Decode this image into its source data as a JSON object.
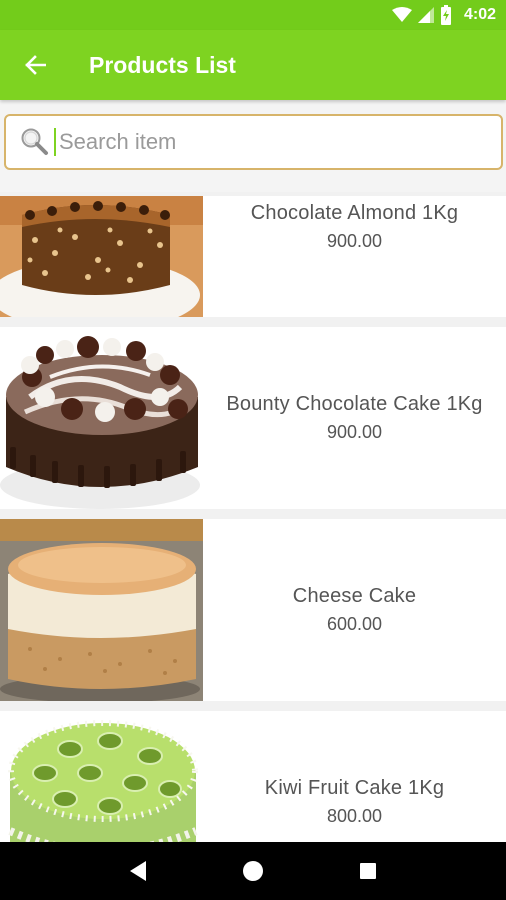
{
  "status_bar": {
    "time": "4:02",
    "icons": [
      "wifi-icon",
      "cell-signal-icon",
      "battery-icon"
    ]
  },
  "app_bar": {
    "title": "Products List",
    "back_icon": "arrow-back-icon",
    "color": "#7ed321"
  },
  "search": {
    "placeholder": "Search item",
    "value": "",
    "icon": "search-icon",
    "border_color": "#d7b46a"
  },
  "products": [
    {
      "name": "Chocolate Almond 1Kg",
      "price": "900.00",
      "image": "chocolate-almond-cake-image"
    },
    {
      "name": "Bounty Chocolate Cake 1Kg",
      "price": "900.00",
      "image": "bounty-chocolate-cake-image"
    },
    {
      "name": "Cheese Cake",
      "price": "600.00",
      "image": "cheese-cake-image"
    },
    {
      "name": "Kiwi Fruit Cake 1Kg",
      "price": "800.00",
      "image": "kiwi-fruit-cake-image"
    }
  ],
  "nav_bar": {
    "icons": [
      "nav-back-icon",
      "nav-home-icon",
      "nav-recents-icon"
    ]
  }
}
